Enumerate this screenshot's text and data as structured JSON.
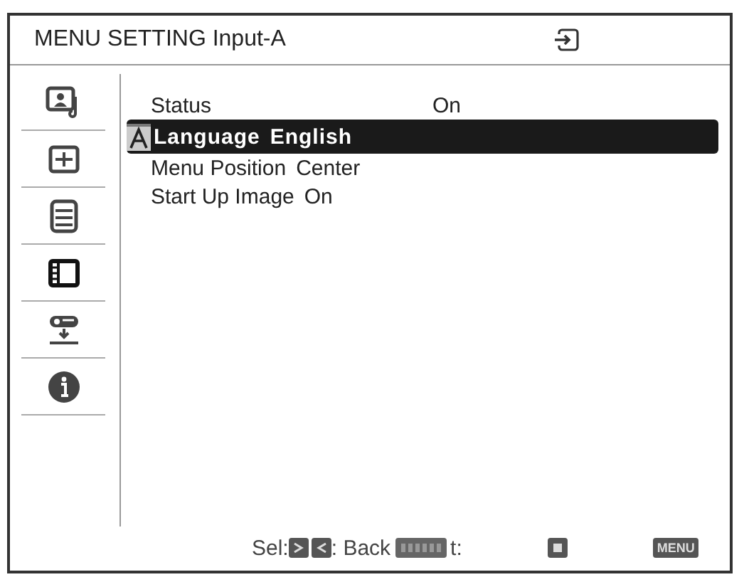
{
  "window": {
    "title": "MENU SETTING Input-A"
  },
  "sidebar": {
    "items": [
      {
        "kind": "picture",
        "selected": false
      },
      {
        "kind": "adjust",
        "selected": false
      },
      {
        "kind": "function",
        "selected": false
      },
      {
        "kind": "menu",
        "selected": true
      },
      {
        "kind": "connection",
        "selected": false
      },
      {
        "kind": "info",
        "selected": false
      }
    ]
  },
  "menu": {
    "items": [
      {
        "label": "Status",
        "value": "On",
        "kind": "column",
        "selected": false
      },
      {
        "label": "Language",
        "value": "English",
        "kind": "inline",
        "selected": true
      },
      {
        "label": "Menu Position",
        "value": "Center",
        "kind": "inline",
        "selected": false
      },
      {
        "label": "Start Up Image",
        "value": "On",
        "kind": "inline",
        "selected": false
      }
    ]
  },
  "status_bar": {
    "items": [
      {
        "kind": "text",
        "text": "Sel:"
      },
      {
        "kind": "arrows"
      },
      {
        "kind": "text",
        "text": ": Back"
      },
      {
        "kind": "enter"
      },
      {
        "kind": "text",
        "text": "t:"
      },
      {
        "kind": "gap"
      },
      {
        "kind": "square"
      },
      {
        "kind": "gap"
      },
      {
        "kind": "key",
        "text": "MENU"
      }
    ]
  }
}
